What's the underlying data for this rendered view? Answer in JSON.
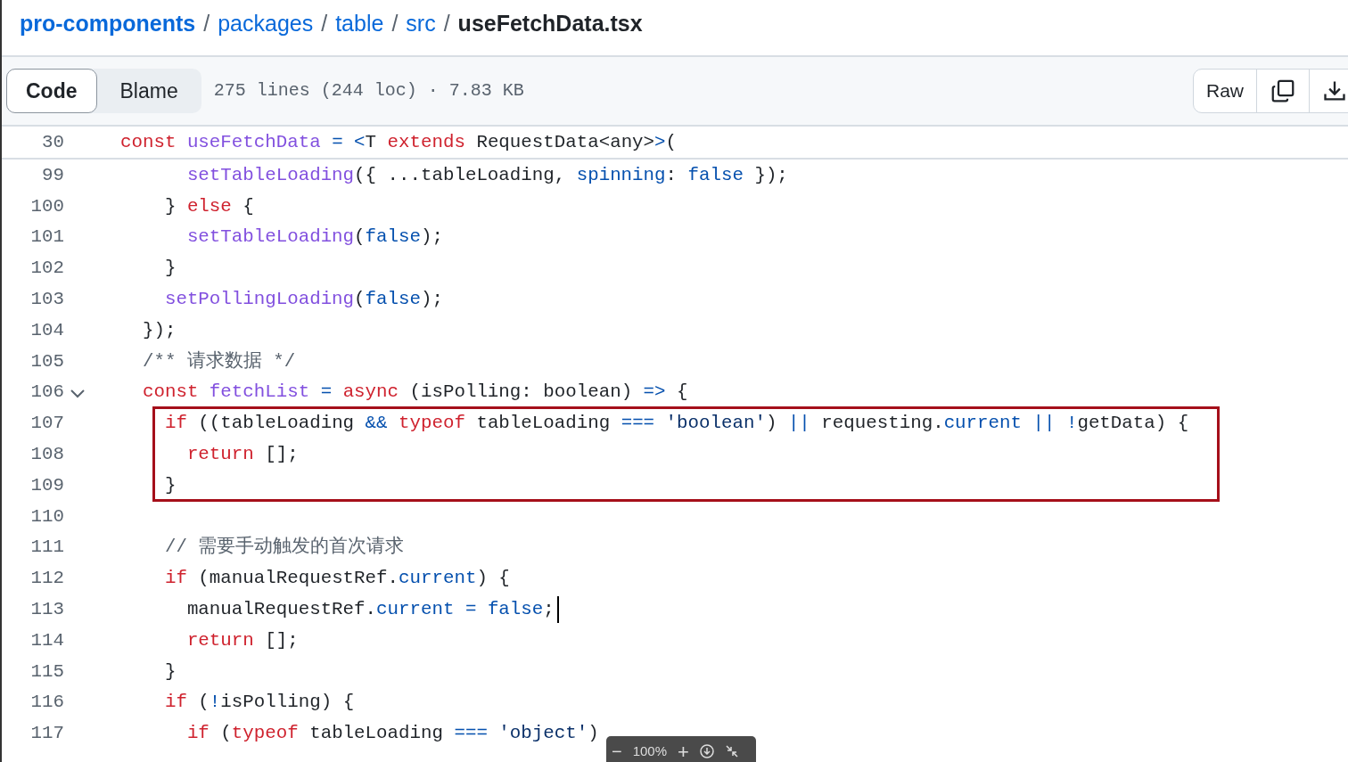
{
  "breadcrumb": [
    {
      "text": "pro-components",
      "kind": "repo"
    },
    {
      "text": "packages",
      "kind": "dir"
    },
    {
      "text": "table",
      "kind": "dir"
    },
    {
      "text": "src",
      "kind": "dir"
    },
    {
      "text": "useFetchData.tsx",
      "kind": "file"
    }
  ],
  "separator": "/",
  "view_tabs": [
    {
      "label": "Code",
      "selected": true
    },
    {
      "label": "Blame",
      "selected": false
    }
  ],
  "file_info": "275 lines (244 loc) · 7.83 KB",
  "raw_button": "Raw",
  "sticky_line": {
    "number": "30",
    "tokens": [
      {
        "kind": "kw",
        "t": "const "
      },
      {
        "kind": "fn",
        "t": "useFetchData"
      },
      {
        "kind": "op",
        "t": " = <"
      },
      {
        "kind": "p",
        "t": "T "
      },
      {
        "kind": "kw",
        "t": "extends"
      },
      {
        "kind": "p",
        "t": " RequestData<any>"
      },
      {
        "kind": "op",
        "t": ">"
      },
      {
        "kind": "p",
        "t": "("
      }
    ]
  },
  "lines": [
    {
      "number": "99",
      "tokens": [
        {
          "kind": "fn",
          "t": "      setTableLoading"
        },
        {
          "kind": "p",
          "t": "({ ...tableLoading, "
        },
        {
          "kind": "c",
          "t": "spinning"
        },
        {
          "kind": "p",
          "t": ": "
        },
        {
          "kind": "c",
          "t": "false"
        },
        {
          "kind": "p",
          "t": " });"
        }
      ]
    },
    {
      "number": "100",
      "tokens": [
        {
          "kind": "p",
          "t": "    } "
        },
        {
          "kind": "kw",
          "t": "else"
        },
        {
          "kind": "p",
          "t": " {"
        }
      ]
    },
    {
      "number": "101",
      "tokens": [
        {
          "kind": "fn",
          "t": "      setTableLoading"
        },
        {
          "kind": "p",
          "t": "("
        },
        {
          "kind": "c",
          "t": "false"
        },
        {
          "kind": "p",
          "t": ");"
        }
      ]
    },
    {
      "number": "102",
      "tokens": [
        {
          "kind": "p",
          "t": "    }"
        }
      ]
    },
    {
      "number": "103",
      "tokens": [
        {
          "kind": "fn",
          "t": "    setPollingLoading"
        },
        {
          "kind": "p",
          "t": "("
        },
        {
          "kind": "c",
          "t": "false"
        },
        {
          "kind": "p",
          "t": ");"
        }
      ]
    },
    {
      "number": "104",
      "tokens": [
        {
          "kind": "p",
          "t": "  });"
        }
      ]
    },
    {
      "number": "105",
      "tokens": [
        {
          "kind": "cm",
          "t": "  /** 请求数据 */"
        }
      ]
    },
    {
      "number": "106",
      "fold": true,
      "tokens": [
        {
          "kind": "kw",
          "t": "  const "
        },
        {
          "kind": "fn",
          "t": "fetchList"
        },
        {
          "kind": "op",
          "t": " = "
        },
        {
          "kind": "kw",
          "t": "async"
        },
        {
          "kind": "p",
          "t": " (isPolling: boolean) "
        },
        {
          "kind": "op",
          "t": "=>"
        },
        {
          "kind": "p",
          "t": " {"
        }
      ]
    },
    {
      "number": "107",
      "highlighted": true,
      "tokens": [
        {
          "kind": "kw",
          "t": "    if"
        },
        {
          "kind": "p",
          "t": " ((tableLoading "
        },
        {
          "kind": "op",
          "t": "&&"
        },
        {
          "kind": "kw",
          "t": " typeof"
        },
        {
          "kind": "p",
          "t": " tableLoading "
        },
        {
          "kind": "op",
          "t": "==="
        },
        {
          "kind": "s",
          "t": " 'boolean'"
        },
        {
          "kind": "p",
          "t": ") "
        },
        {
          "kind": "op",
          "t": "||"
        },
        {
          "kind": "p",
          "t": " requesting."
        },
        {
          "kind": "c",
          "t": "current"
        },
        {
          "kind": "op",
          "t": " || !"
        },
        {
          "kind": "p",
          "t": "getData) {"
        }
      ]
    },
    {
      "number": "108",
      "highlighted": true,
      "tokens": [
        {
          "kind": "kw",
          "t": "      return"
        },
        {
          "kind": "p",
          "t": " [];"
        }
      ]
    },
    {
      "number": "109",
      "highlighted": true,
      "tokens": [
        {
          "kind": "p",
          "t": "    }"
        }
      ]
    },
    {
      "number": "110"
    },
    {
      "number": "111",
      "tokens": [
        {
          "kind": "cm",
          "t": "    // 需要手动触发的首次请求"
        }
      ]
    },
    {
      "number": "112",
      "tokens": [
        {
          "kind": "kw",
          "t": "    if"
        },
        {
          "kind": "p",
          "t": " (manualRequestRef."
        },
        {
          "kind": "c",
          "t": "current"
        },
        {
          "kind": "p",
          "t": ") {"
        }
      ]
    },
    {
      "number": "113",
      "cursor": true,
      "tokens": [
        {
          "kind": "p",
          "t": "      manualRequestRef."
        },
        {
          "kind": "c",
          "t": "current"
        },
        {
          "kind": "op",
          "t": " = "
        },
        {
          "kind": "c",
          "t": "false"
        },
        {
          "kind": "p",
          "t": ";"
        }
      ]
    },
    {
      "number": "114",
      "tokens": [
        {
          "kind": "kw",
          "t": "      return"
        },
        {
          "kind": "p",
          "t": " [];"
        }
      ]
    },
    {
      "number": "115",
      "tokens": [
        {
          "kind": "p",
          "t": "    }"
        }
      ]
    },
    {
      "number": "116",
      "tokens": [
        {
          "kind": "kw",
          "t": "    if"
        },
        {
          "kind": "p",
          "t": " ("
        },
        {
          "kind": "op",
          "t": "!"
        },
        {
          "kind": "p",
          "t": "isPolling) {"
        }
      ]
    },
    {
      "number": "117",
      "tokens": [
        {
          "kind": "kw",
          "t": "      if"
        },
        {
          "kind": "p",
          "t": " ("
        },
        {
          "kind": "kw",
          "t": "typeof"
        },
        {
          "kind": "p",
          "t": " tableLoading "
        },
        {
          "kind": "op",
          "t": "==="
        },
        {
          "kind": "s",
          "t": " 'object'"
        },
        {
          "kind": "p",
          "t": ")"
        }
      ]
    }
  ],
  "zoom_bar": {
    "minus": "−",
    "level": "100%",
    "plus": "+"
  }
}
